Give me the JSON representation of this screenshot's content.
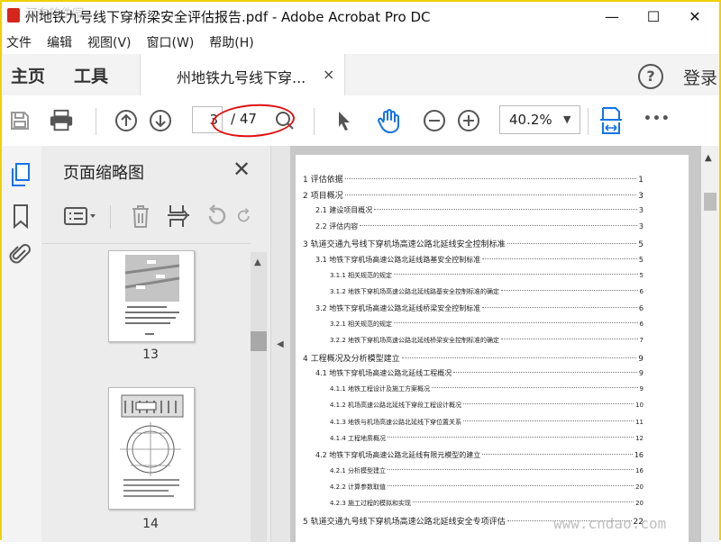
{
  "window": {
    "title": "州地铁九号线下穿桥梁安全评估报告.pdf - Adobe Acrobat Pro DC",
    "watermark": "河东软件园",
    "controls": {
      "minimize": "—",
      "maximize": "☐",
      "close": "✕"
    }
  },
  "menubar": {
    "items": [
      "文件",
      "编辑",
      "视图(V)",
      "窗口(W)",
      "帮助(H)"
    ]
  },
  "navbar": {
    "home": "主页",
    "tools": "工具",
    "tab_title": "州地铁九号线下穿...",
    "tab_close": "×",
    "help": "?",
    "login": "登录"
  },
  "toolbar": {
    "page_current": "3",
    "page_total": "/ 47",
    "zoom": "40.2%",
    "zoom_caret": "▼",
    "more": "•••"
  },
  "thumbnails": {
    "title": "页面缩略图",
    "close": "✕",
    "pages": [
      {
        "number": "13"
      },
      {
        "number": "14"
      }
    ]
  },
  "document": {
    "toc": [
      {
        "text": "1  评估依据",
        "page": "1",
        "level": 0
      },
      {
        "text": "2  项目概况",
        "page": "3",
        "level": 0
      },
      {
        "text": "2.1  建设项目概况",
        "page": "3",
        "level": 1
      },
      {
        "text": "2.2  评估内容",
        "page": "3",
        "level": 1
      },
      {
        "text": "3 轨道交通九号线下穿机场高速公路北延线安全控制标准",
        "page": "5",
        "level": 0
      },
      {
        "text": "3.1  地铁下穿机场高速公路北延线路基安全控制标准",
        "page": "5",
        "level": 1
      },
      {
        "text": "3.1.1  相关规范的规定",
        "page": "5",
        "level": 2
      },
      {
        "text": "3.1.2  地铁下穿机场高速公路北延线路基安全控制标准的确定",
        "page": "6",
        "level": 2
      },
      {
        "text": "3.2  地铁下穿机场高速公路北延线桥梁安全控制标准",
        "page": "6",
        "level": 1
      },
      {
        "text": "3.2.1  相关规范的规定",
        "page": "6",
        "level": 2
      },
      {
        "text": "3.2.2  地铁下穿机场高速公路北延线桥梁安全控制标准的确定",
        "page": "7",
        "level": 2
      },
      {
        "text": "4 工程概况及分析模型建立",
        "page": "9",
        "level": 0
      },
      {
        "text": "4.1  地铁下穿机场高速公路北延线工程概况",
        "page": "9",
        "level": 1
      },
      {
        "text": "4.1.1  地铁工程设计及施工方案概况",
        "page": "9",
        "level": 2
      },
      {
        "text": "4.1.2  机场高速公路北延线下穿段工程设计概况",
        "page": "10",
        "level": 2
      },
      {
        "text": "4.1.3  地铁与机场高速公路北延线下穿位置关系",
        "page": "11",
        "level": 2
      },
      {
        "text": "4.1.4  工程地质概况",
        "page": "12",
        "level": 2
      },
      {
        "text": "4.2  地铁下穿机场高速公路北延线有限元模型的建立",
        "page": "16",
        "level": 1
      },
      {
        "text": "4.2.1  分析模型建立",
        "page": "16",
        "level": 2
      },
      {
        "text": "4.2.2  计算参数取值",
        "page": "20",
        "level": 2
      },
      {
        "text": "4.2.3  施工过程的模拟和实现",
        "page": "20",
        "level": 2
      },
      {
        "text": "5  轨道交通九号线下穿机场高速公路北延线安全专项评估",
        "page": "22",
        "level": 0
      }
    ]
  },
  "site_watermark": "www.cndao.com",
  "colors": {
    "accent_blue": "#1473e6",
    "icon_gray": "#555555",
    "highlight_red": "#e01010",
    "window_border": "#f0d000"
  }
}
